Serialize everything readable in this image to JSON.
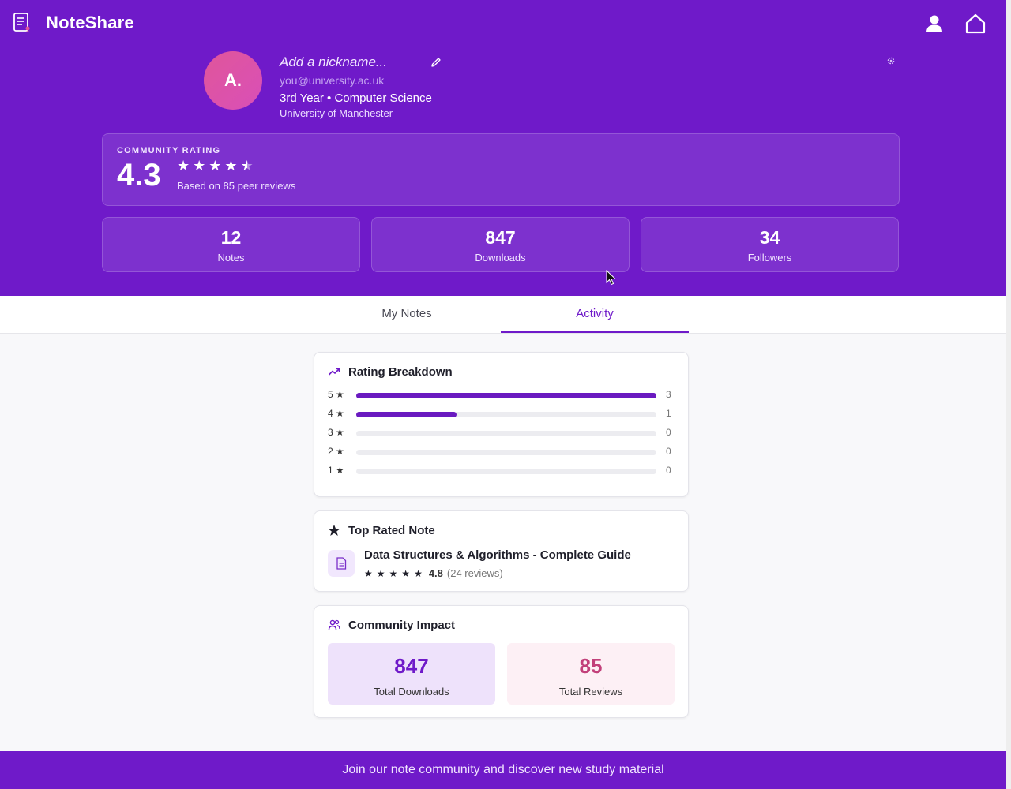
{
  "app": {
    "brand": "NoteShare",
    "icons": {
      "logo": "document-user-icon",
      "profile": "user-icon",
      "home": "home-icon"
    }
  },
  "profile": {
    "avatar_initials": "A.",
    "nickname_placeholder": "Add a nickname...",
    "email": "you@university.ac.uk",
    "year_course": "3rd Year • Computer Science",
    "university": "University of Manchester"
  },
  "community_rating": {
    "label": "COMMUNITY RATING",
    "value": "4.3",
    "stars_value": 4.3,
    "summary": "Based on 85 peer reviews"
  },
  "stats": [
    {
      "value": "12",
      "label": "Notes"
    },
    {
      "value": "847",
      "label": "Downloads"
    },
    {
      "value": "34",
      "label": "Followers"
    }
  ],
  "tabs": [
    {
      "label": "My Notes",
      "active": false
    },
    {
      "label": "Activity",
      "active": true
    }
  ],
  "rating_breakdown": {
    "title": "Rating Breakdown",
    "rows": [
      {
        "label": "5 ★",
        "count": "3",
        "fraction": 1.0
      },
      {
        "label": "4 ★",
        "count": "1",
        "fraction": 0.333
      },
      {
        "label": "3 ★",
        "count": "0",
        "fraction": 0
      },
      {
        "label": "2 ★",
        "count": "0",
        "fraction": 0
      },
      {
        "label": "1 ★",
        "count": "0",
        "fraction": 0
      }
    ]
  },
  "top_rated": {
    "title": "Top Rated Note",
    "note_title": "Data Structures & Algorithms - Complete Guide",
    "score": "4.8",
    "reviews": "(24 reviews)"
  },
  "impact": {
    "title": "Community Impact",
    "downloads_value": "847",
    "downloads_label": "Total Downloads",
    "reviews_value": "85",
    "reviews_label": "Total Reviews"
  },
  "footer": {
    "text": "Join our note community and discover new study material"
  },
  "colors": {
    "primary": "#6f1ac9",
    "accent_pink": "#c2407a",
    "impact_purple_bg": "#eee2fb",
    "impact_pink_bg": "#fdf0f5"
  }
}
